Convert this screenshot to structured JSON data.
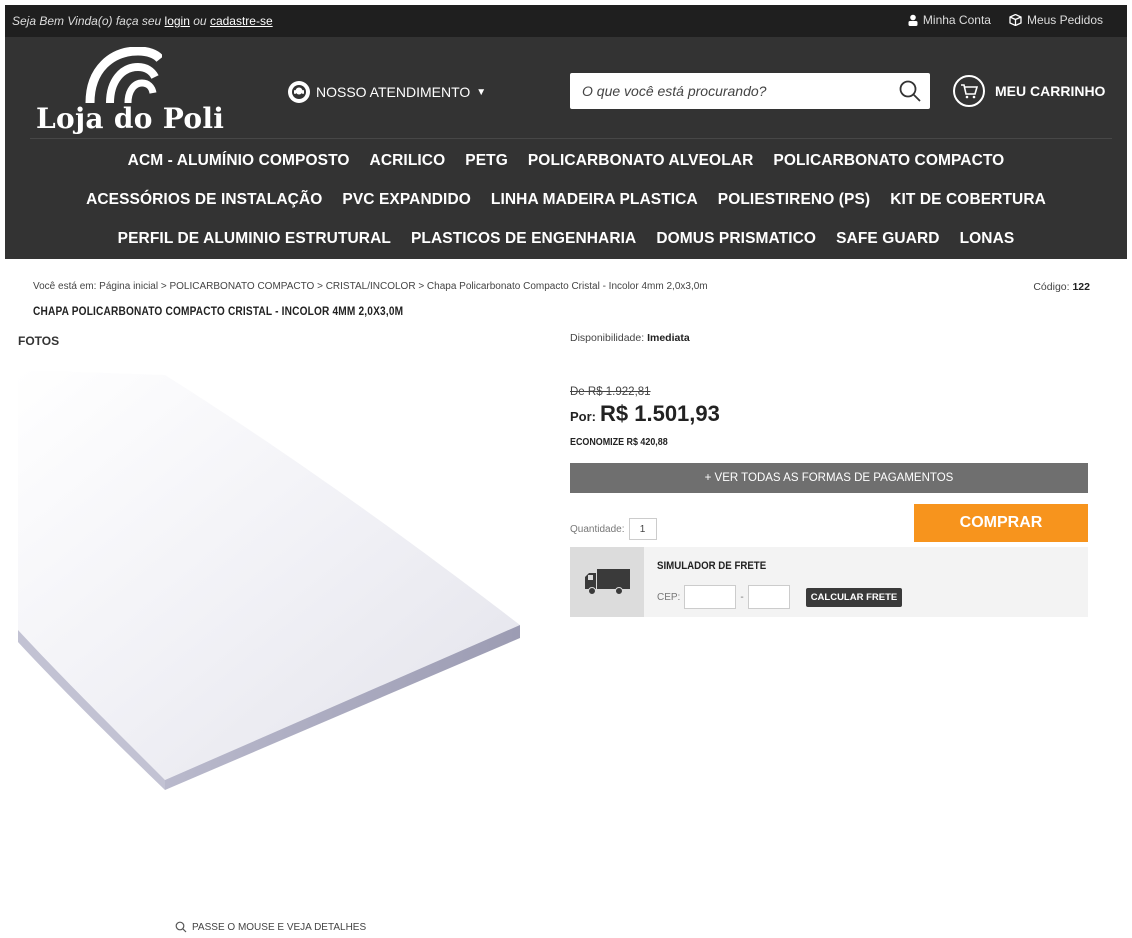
{
  "topbar": {
    "welcome": "Seja Bem Vinda(o) faça seu",
    "login": "login",
    "or": "ou",
    "register": "cadastre-se",
    "account": "Minha Conta",
    "orders": "Meus Pedidos"
  },
  "header": {
    "logo_text": "Loja do Poli",
    "support": "NOSSO ATENDIMENTO",
    "search_placeholder": "O que você está procurando?",
    "cart": "MEU CARRINHO"
  },
  "nav": {
    "row1": [
      "ACM - ALUMÍNIO COMPOSTO",
      "ACRILICO",
      "PETG",
      "POLICARBONATO ALVEOLAR",
      "POLICARBONATO COMPACTO"
    ],
    "row2": [
      "ACESSÓRIOS DE INSTALAÇÃO",
      "PVC EXPANDIDO",
      "LINHA MADEIRA PLASTICA",
      "POLIESTIRENO (PS)",
      "KIT DE COBERTURA"
    ],
    "row3": [
      "PERFIL DE ALUMINIO ESTRUTURAL",
      "PLASTICOS DE ENGENHARIA",
      "DOMUS PRISMATICO",
      "SAFE GUARD",
      "LONAS"
    ]
  },
  "product": {
    "breadcrumb": "Você está em: Página inicial > POLICARBONATO COMPACTO > CRISTAL/INCOLOR > Chapa Policarbonato Compacto Cristal - Incolor 4mm 2,0x3,0m",
    "code_label": "Código:",
    "code_value": "122",
    "title": "CHAPA POLICARBONATO COMPACTO CRISTAL - INCOLOR 4MM 2,0X3,0M",
    "photos_label": "FOTOS",
    "zoom_hint": "PASSE O MOUSE E VEJA DETALHES",
    "availability_label": "Disponibilidade:",
    "availability_value": "Imediata",
    "old_price": "De R$ 1.922,81",
    "price_label": "Por:",
    "price": "R$ 1.501,93",
    "savings": "ECONOMIZE  R$ 420,88",
    "payment_button": "+ VER TODAS AS FORMAS DE PAGAMENTOS",
    "quantity_label": "Quantidade:",
    "quantity_value": "1",
    "buy_button": "COMPRAR",
    "shipping_title": "SIMULADOR DE FRETE",
    "cep_label": "CEP:",
    "cep_separator": "-",
    "calc_button": "CALCULAR FRETE"
  },
  "colors": {
    "header_bg": "#333333",
    "topbar_bg": "#1f1f1f",
    "buy_orange": "#f7941d",
    "payment_gray": "#6f6f6f"
  }
}
